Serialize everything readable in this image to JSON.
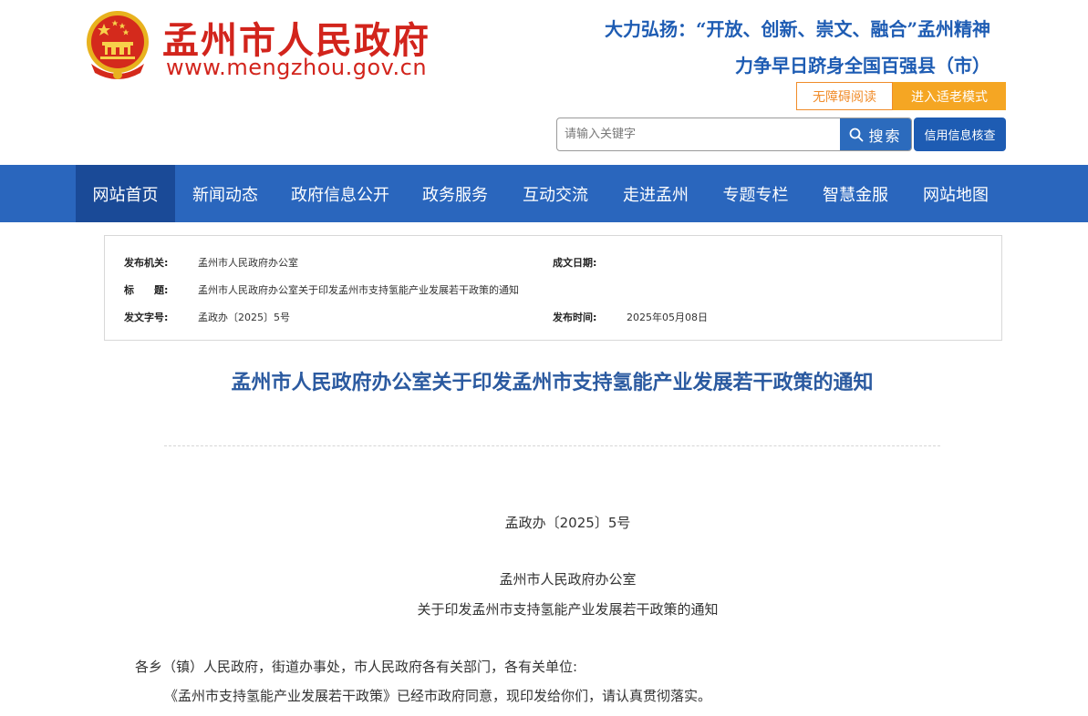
{
  "header": {
    "site_name": "孟州市人民政府",
    "site_url": "www.mengzhou.gov.cn",
    "slogan_line1": "大力弘扬：“开放、创新、崇文、融合”孟州精神",
    "slogan_line2": "力争早日跻身全国百强县（市）",
    "accessible_label": "无障碍阅读",
    "elderly_mode_label": "进入适老模式",
    "search_placeholder": "请输入关键字",
    "search_button_label": "搜索",
    "credit_button_label": "信用信息核查"
  },
  "nav": {
    "items": [
      {
        "label": "网站首页",
        "active": true
      },
      {
        "label": "新闻动态"
      },
      {
        "label": "政府信息公开"
      },
      {
        "label": "政务服务"
      },
      {
        "label": "互动交流"
      },
      {
        "label": "走进孟州"
      },
      {
        "label": "专题专栏"
      },
      {
        "label": "智慧金服"
      },
      {
        "label": "网站地图"
      }
    ]
  },
  "info": {
    "issuer_label": "发布机关:",
    "issuer": "孟州市人民政府办公室",
    "date_written_label": "成文日期:",
    "date_written": "",
    "title_label": "标　　题:",
    "title": "孟州市人民政府办公室关于印发孟州市支持氢能产业发展若干政策的通知",
    "doc_no_label": "发文字号:",
    "doc_no": "孟政办〔2025〕5号",
    "publish_time_label": "发布时间:",
    "publish_time": "2025年05月08日"
  },
  "article": {
    "title": "孟州市人民政府办公室关于印发孟州市支持氢能产业发展若干政策的通知",
    "doc_no": "孟政办〔2025〕5号",
    "issuer": "孟州市人民政府办公室",
    "subtitle": "关于印发孟州市支持氢能产业发展若干政策的通知",
    "salutation": "各乡（镇）人民政府，街道办事处，市人民政府各有关部门，各有关单位:",
    "paragraph1": "《孟州市支持氢能产业发展若干政策》已经市政府同意，现印发给你们，请认真贯彻落实。"
  },
  "colors": {
    "brand_red": "#d2241c",
    "nav_blue": "#2a66bd",
    "nav_active": "#1a4a97",
    "slogan_blue": "#1e5cb3",
    "orange": "#f5a623"
  }
}
